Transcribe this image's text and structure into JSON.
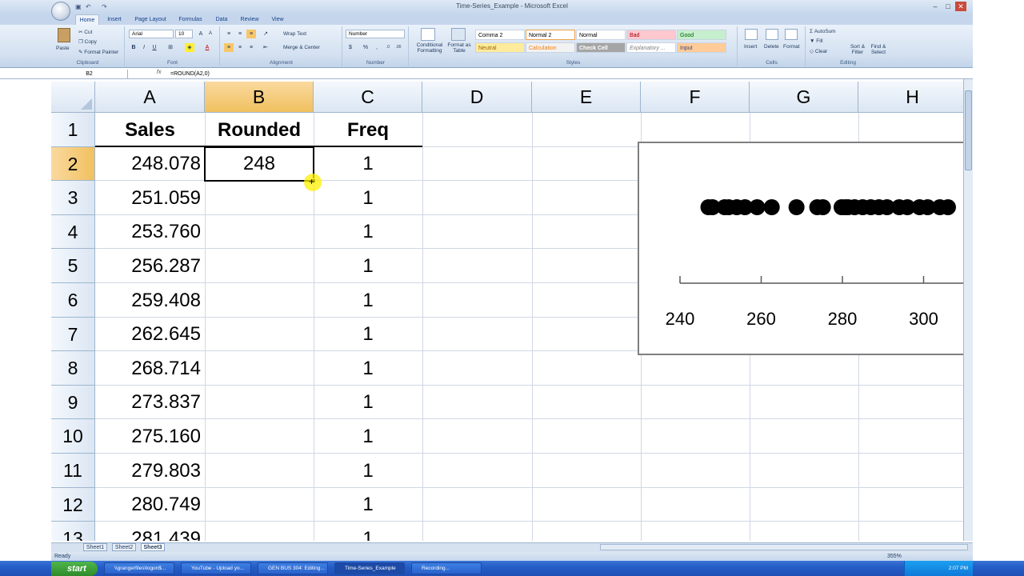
{
  "window": {
    "title": "Time-Series_Example - Microsoft Excel"
  },
  "ribbon": {
    "tabs": [
      "Home",
      "Insert",
      "Page Layout",
      "Formulas",
      "Data",
      "Review",
      "View"
    ],
    "clipboard": {
      "paste": "Paste",
      "cut": "Cut",
      "copy": "Copy",
      "format_painter": "Format Painter",
      "label": "Clipboard"
    },
    "font": {
      "name": "Arial",
      "size": "10",
      "label": "Font"
    },
    "alignment": {
      "wrap": "Wrap Text",
      "merge": "Merge & Center",
      "label": "Alignment"
    },
    "number": {
      "format": "Number",
      "label": "Number"
    },
    "styles": {
      "cond": "Conditional Formatting",
      "astable": "Format as Table",
      "label": "Styles",
      "items": [
        [
          "Comma 2",
          "Normal 2",
          "Normal",
          "Bad",
          "Good"
        ],
        [
          "Neutral",
          "Calculation",
          "Check Cell",
          "Explanatory ...",
          "Input"
        ]
      ]
    },
    "cells": {
      "insert": "Insert",
      "delete": "Delete",
      "format": "Format",
      "label": "Cells"
    },
    "editing": {
      "autosum": "AutoSum",
      "fill": "Fill",
      "clear": "Clear",
      "sort": "Sort & Filter",
      "find": "Find & Select",
      "label": "Editing"
    }
  },
  "formula_bar": {
    "name_box": "B2",
    "fx": "fx",
    "formula": "=ROUND(A2,0)"
  },
  "sheet": {
    "columns": [
      "A",
      "B",
      "C",
      "D",
      "E",
      "F",
      "G",
      "H"
    ],
    "rows": [
      "1",
      "2",
      "3",
      "4",
      "5",
      "6",
      "7",
      "8",
      "9",
      "10",
      "11",
      "12",
      "13"
    ],
    "header_row": {
      "a": "Sales",
      "b": "Rounded",
      "c": "Freq"
    },
    "sales": [
      "248.078",
      "251.059",
      "253.760",
      "256.287",
      "259.408",
      "262.645",
      "268.714",
      "273.837",
      "275.160",
      "279.803",
      "280.749",
      "281.439"
    ],
    "rounded_b2": "248",
    "freq": [
      "1",
      "1",
      "1",
      "1",
      "1",
      "1",
      "1",
      "1",
      "1",
      "1",
      "1",
      "1"
    ]
  },
  "chart_data": {
    "type": "scatter",
    "title": "",
    "xlabel": "",
    "ylabel": "",
    "x_ticks": [
      240,
      260,
      280,
      300
    ],
    "xlim": [
      240,
      310
    ],
    "points_x": [
      247,
      248,
      251,
      252,
      254,
      256,
      259,
      262.6,
      268.7,
      273.8,
      275.2,
      279.8,
      280.7,
      281.4,
      283,
      285,
      287,
      289,
      291,
      294,
      296,
      299,
      301,
      304,
      306
    ],
    "grid": false
  },
  "sheets": {
    "tabs": [
      "Sheet1",
      "Sheet2",
      "Sheet3"
    ],
    "active": "Sheet3"
  },
  "status": {
    "ready": "Ready",
    "zoom": "355%"
  },
  "taskbar": {
    "start": "start",
    "items": [
      "\\\\grangerfiles\\logon$...",
      "YouTube - Upload yo...",
      "GEN BUS 304: Editing...",
      "Time-Series_Example",
      "Recording..."
    ],
    "clock": "2:07 PM"
  }
}
